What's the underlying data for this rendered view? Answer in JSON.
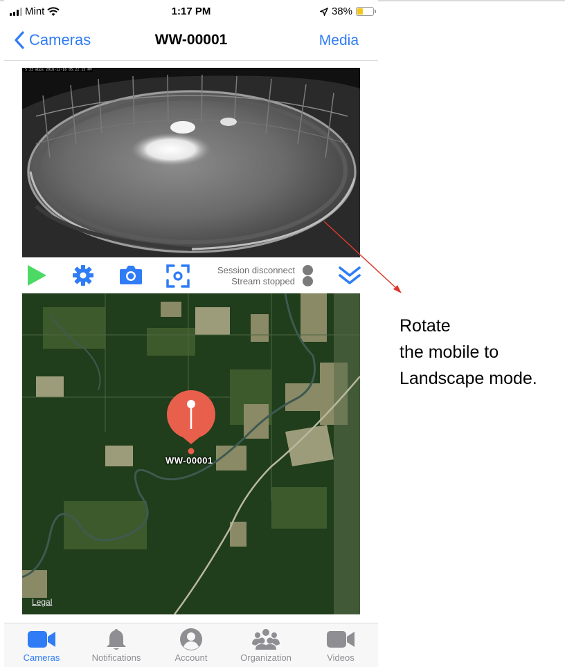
{
  "status_bar": {
    "carrier": "Mint",
    "time": "1:17 PM",
    "battery_percent": "38%",
    "battery_level": 0.38
  },
  "nav": {
    "back_label": "Cameras",
    "title": "WW-00001",
    "media_label": "Media"
  },
  "video": {
    "osd_text": "5:33 mbps 2018-12-16 05:22:15 PM"
  },
  "controls": {
    "session_status": "Session disconnect",
    "stream_status": "Stream stopped",
    "play_color": "#4cd964",
    "accent_color": "#2f7cf6"
  },
  "map": {
    "pin_label": "WW-00001",
    "legal_label": "Legal",
    "pin_color": "#e8604c"
  },
  "tabs": [
    {
      "label": "Cameras",
      "icon": "video-camera-icon",
      "active": true
    },
    {
      "label": "Notifications",
      "icon": "bell-icon",
      "active": false
    },
    {
      "label": "Account",
      "icon": "account-icon",
      "active": false
    },
    {
      "label": "Organization",
      "icon": "organization-icon",
      "active": false
    },
    {
      "label": "Videos",
      "icon": "video-icon",
      "active": false
    }
  ],
  "annotation": {
    "line1": "Rotate",
    "line2": "the mobile to",
    "line3": "Landscape mode.",
    "arrow_color": "#d93a2b"
  }
}
